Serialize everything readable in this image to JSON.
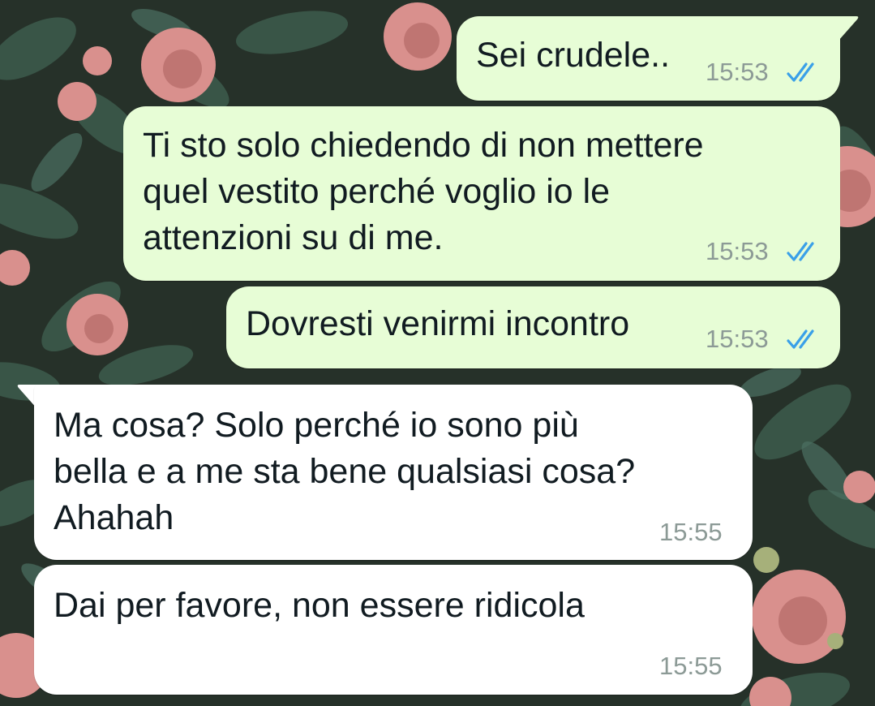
{
  "conversation": {
    "messages": [
      {
        "direction": "outgoing",
        "lines": [
          "Sei crudele.."
        ],
        "time": "15:53",
        "status": "read-double-check-icon"
      },
      {
        "direction": "outgoing",
        "lines": [
          "Ti sto solo chiedendo di non mettere",
          "quel vestito perché voglio io le",
          "attenzioni su di me."
        ],
        "time": "15:53",
        "status": "read-double-check-icon"
      },
      {
        "direction": "outgoing",
        "lines": [
          "Dovresti venirmi incontro"
        ],
        "time": "15:53",
        "status": "read-double-check-icon"
      },
      {
        "direction": "incoming",
        "lines": [
          "Ma cosa? Solo perché io sono più",
          "bella e a me sta bene qualsiasi cosa?",
          "Ahahah"
        ],
        "time": "15:55"
      },
      {
        "direction": "incoming",
        "lines": [
          "Dai per favore, non essere ridicola"
        ],
        "time": "15:55"
      }
    ]
  },
  "colors": {
    "outgoing_bubble": "#e7fdd6",
    "incoming_bubble": "#ffffff",
    "read_ticks": "#3aa0e8",
    "timestamp": "#8c9a96",
    "wallpaper_leaves": "#2f4a3e",
    "wallpaper_flowers": "#d98f8c"
  }
}
